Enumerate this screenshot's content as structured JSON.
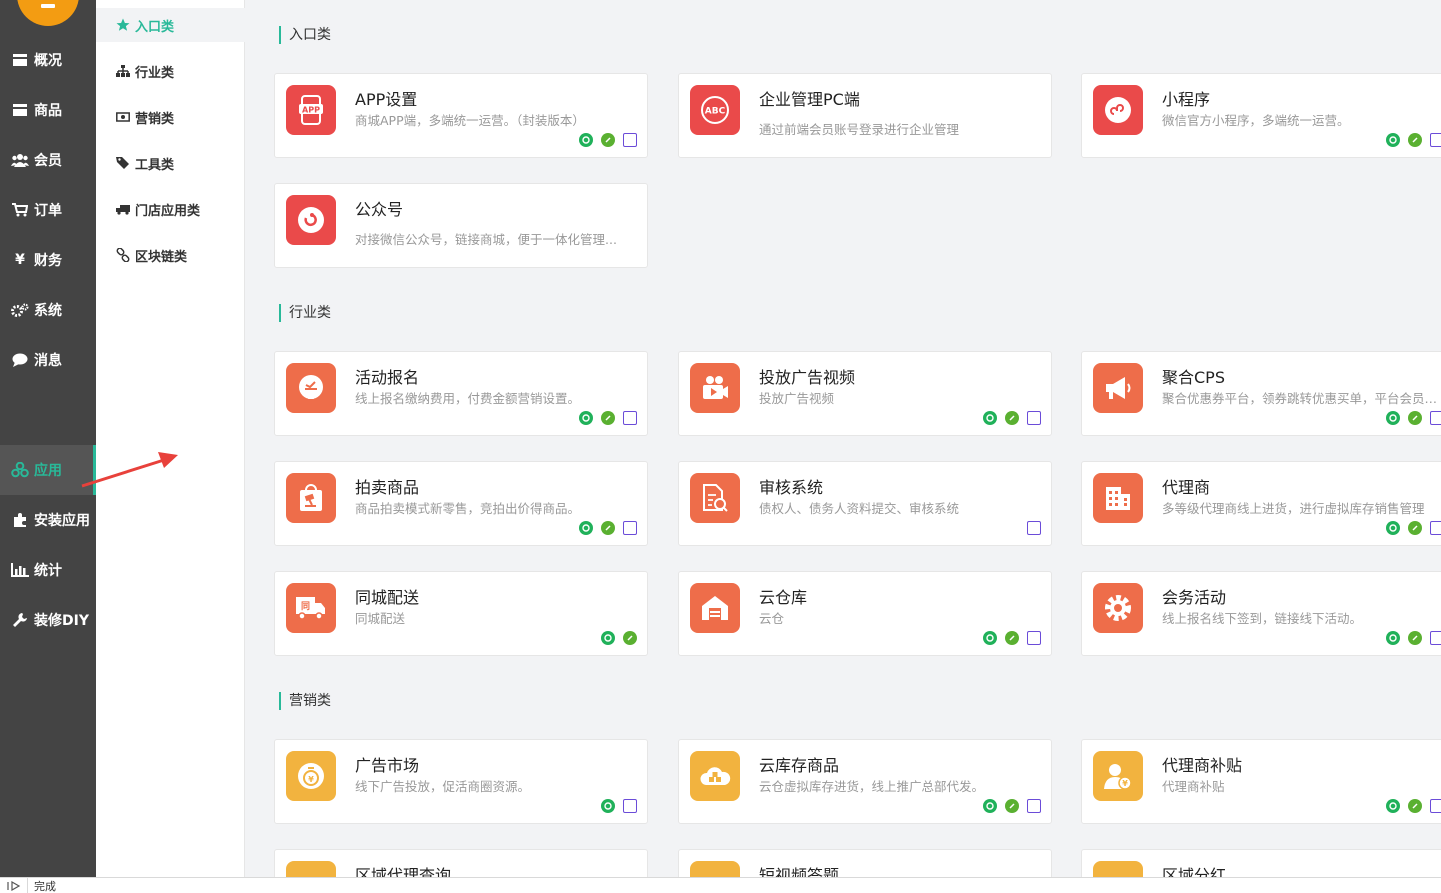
{
  "sidebar": {
    "items": [
      {
        "label": "概况",
        "icon": "card-icon"
      },
      {
        "label": "商品",
        "icon": "box-icon"
      },
      {
        "label": "会员",
        "icon": "users-icon"
      },
      {
        "label": "订单",
        "icon": "cart-icon"
      },
      {
        "label": "财务",
        "icon": "yen-icon"
      },
      {
        "label": "系统",
        "icon": "gears-icon"
      },
      {
        "label": "消息",
        "icon": "chat-icon"
      },
      {
        "label": "应用",
        "icon": "cubes-icon",
        "active": true
      },
      {
        "label": "安装应用",
        "icon": "puzzle-icon"
      },
      {
        "label": "统计",
        "icon": "bar-chart-icon"
      },
      {
        "label": "装修DIY",
        "icon": "wrench-icon"
      }
    ]
  },
  "subnav": {
    "items": [
      {
        "label": "入口类",
        "icon": "star-icon",
        "active": true
      },
      {
        "label": "行业类",
        "icon": "sitemap-icon"
      },
      {
        "label": "营销类",
        "icon": "money-icon"
      },
      {
        "label": "工具类",
        "icon": "tags-icon"
      },
      {
        "label": "门店应用类",
        "icon": "truck-icon"
      },
      {
        "label": "区块链类",
        "icon": "link-icon"
      }
    ]
  },
  "sections": [
    {
      "title": "入口类"
    },
    {
      "title": "行业类"
    },
    {
      "title": "营销类"
    }
  ],
  "cards": [
    {
      "title": "APP设置",
      "desc": "商城APP端，多端统一运营。（封装版本）",
      "icon": "app-icon",
      "color": "#ea4a4a"
    },
    {
      "title": "企业管理PC端",
      "desc": "通过前端会员账号登录进行企业管理",
      "icon": "abc-icon",
      "color": "#ea4a4a"
    },
    {
      "title": "小程序",
      "desc": "微信官方小程序，多端统一运营。",
      "icon": "miniprogram-icon",
      "color": "#ea4a4a"
    },
    {
      "title": "公众号",
      "desc": "对接微信公众号，链接商城，便于一体化管理...",
      "icon": "official-account-icon",
      "color": "#ea4a4a"
    },
    {
      "title": "活动报名",
      "desc": "线上报名缴纳费用，付费金额营销设置。",
      "icon": "signup-icon",
      "color": "#ee6d4a"
    },
    {
      "title": "投放广告视频",
      "desc": "投放广告视频",
      "icon": "video-camera-icon",
      "color": "#ee6d4a"
    },
    {
      "title": "聚合CPS",
      "desc": "聚合优惠券平台，领券跳转优惠买单，平台会员返佣金",
      "icon": "megaphone-icon",
      "color": "#ee6d4a"
    },
    {
      "title": "拍卖商品",
      "desc": "商品拍卖模式新零售，竞拍出价得商品。",
      "icon": "auction-icon",
      "color": "#ee6d4a"
    },
    {
      "title": "审核系统",
      "desc": "债权人、债务人资料提交、审核系统",
      "icon": "audit-icon",
      "color": "#ee6d4a"
    },
    {
      "title": "代理商",
      "desc": "多等级代理商线上进货，进行虚拟库存销售管理",
      "icon": "building-icon",
      "color": "#ee6d4a"
    },
    {
      "title": "同城配送",
      "desc": "同城配送",
      "icon": "delivery-truck-icon",
      "color": "#ee6d4a"
    },
    {
      "title": "云仓库",
      "desc": "云仓",
      "icon": "warehouse-icon",
      "color": "#ee6d4a"
    },
    {
      "title": "会务活动",
      "desc": "线上报名线下签到，链接线下活动。",
      "icon": "gear-icon",
      "color": "#ee6d4a"
    },
    {
      "title": "广告市场",
      "desc": "线下广告投放，促活商圈资源。",
      "icon": "money-bag-icon",
      "color": "#f2b33f"
    },
    {
      "title": "云库存商品",
      "desc": "云仓虚拟库存进货，线上推广总部代发。",
      "icon": "cloud-box-icon",
      "color": "#f2b33f"
    },
    {
      "title": "代理商补贴",
      "desc": "代理商补贴",
      "icon": "user-yen-icon",
      "color": "#f2b33f"
    },
    {
      "title": "区域代理查询",
      "desc": "",
      "icon": "region-icon",
      "color": "#f2b33f"
    },
    {
      "title": "短视频答题",
      "desc": "",
      "icon": "quiz-icon",
      "color": "#f2b33f"
    },
    {
      "title": "区域分红",
      "desc": "",
      "icon": "dividend-icon",
      "color": "#f2b33f"
    }
  ],
  "status": {
    "text": "完成"
  }
}
